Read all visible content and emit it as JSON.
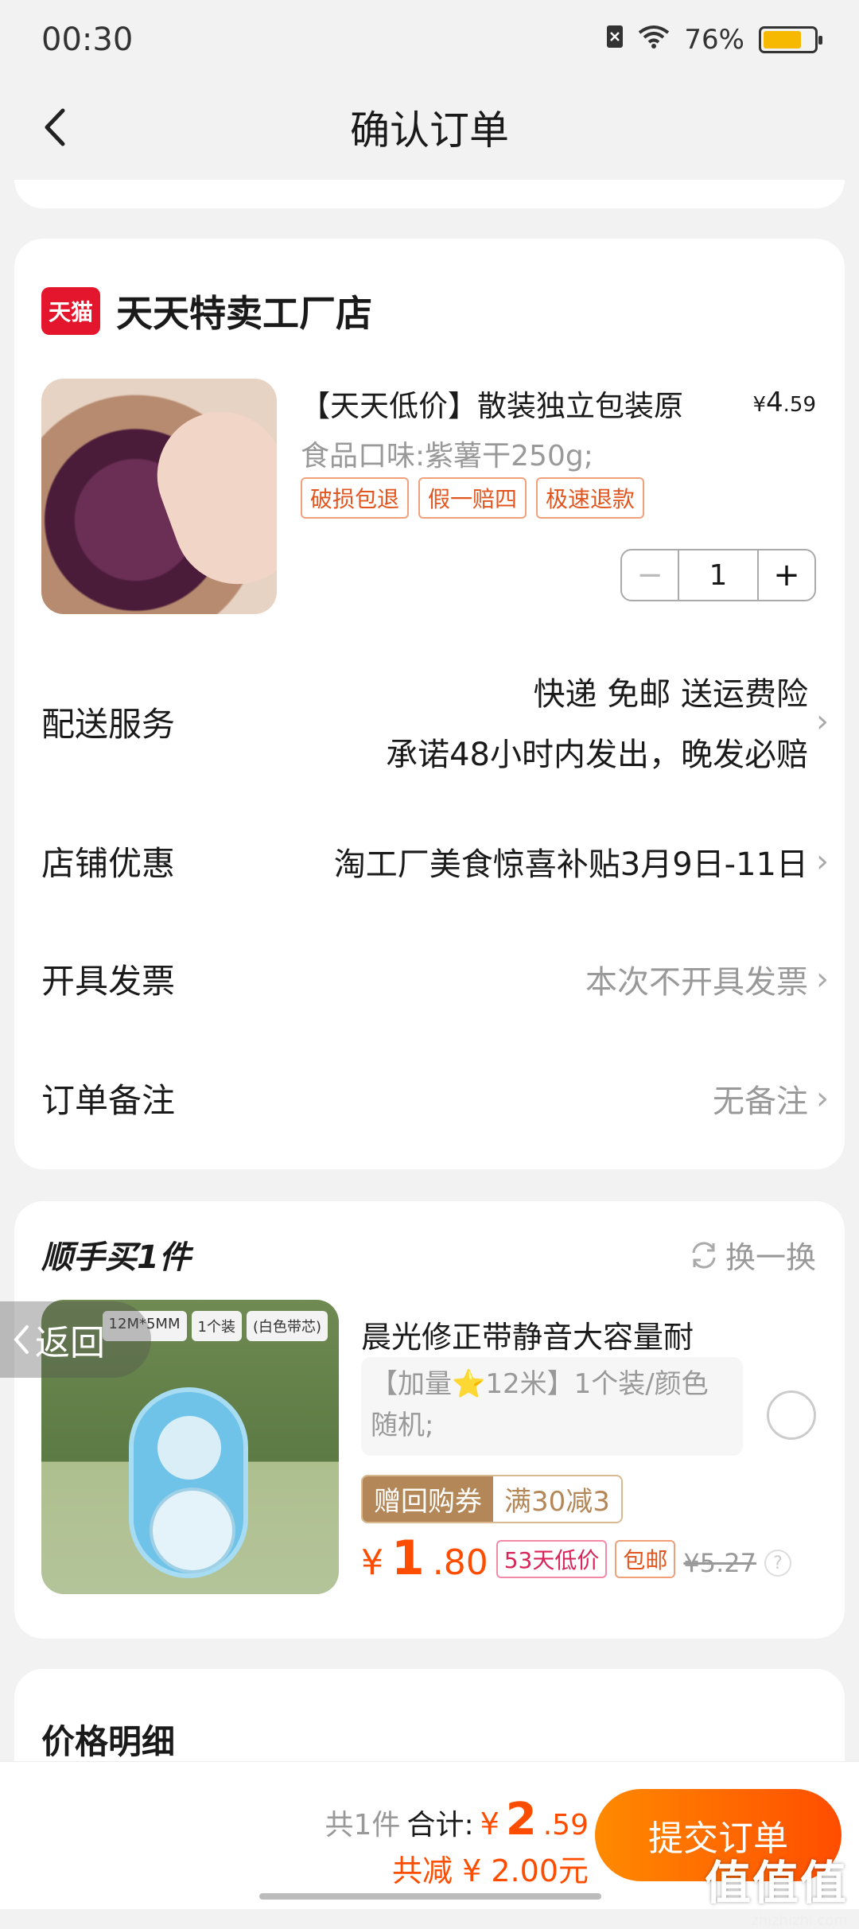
{
  "status": {
    "time": "00:30",
    "battery": "76%",
    "battery_level": 0.76
  },
  "nav": {
    "title": "确认订单"
  },
  "store": {
    "logo_text": "天猫",
    "name": "天天特卖工厂店",
    "product": {
      "title": "【天天低价】散装独立包装原",
      "price_symbol": "¥",
      "price_int": "4",
      "price_dec": ".59",
      "spec": "食品口味:紫薯干250g;",
      "tags": [
        "破损包退",
        "假一赔四",
        "极速退款"
      ],
      "quantity": "1",
      "minus": "−",
      "plus": "+"
    },
    "rows": {
      "shipping": {
        "label": "配送服务",
        "line1": "快递 免邮 送运费险",
        "line2": "承诺48小时内发出，晚发必赔"
      },
      "discount": {
        "label": "店铺优惠",
        "value": "淘工厂美食惊喜补贴3月9日-11日"
      },
      "invoice": {
        "label": "开具发票",
        "value": "本次不开具发票"
      },
      "note": {
        "label": "订单备注",
        "value": "无备注"
      }
    }
  },
  "addon": {
    "title": "顺手买1件",
    "swap_label": "换一换",
    "image_badges": [
      "12M*5MM",
      "1个装",
      "(白色带芯)"
    ],
    "name": "晨光修正带静音大容量耐",
    "spec": "【加量⭐12米】1个装/颜色随机;",
    "coupon_a": "赠回购券",
    "coupon_b": "满30减3",
    "price_symbol": "¥",
    "price_int": "1",
    "price_dec": ".80",
    "tag_low": "53天低价",
    "tag_ship": "包邮",
    "original_price": "¥5.27"
  },
  "return_pill": {
    "label": "返回"
  },
  "price_detail": {
    "title": "价格明细"
  },
  "bottom": {
    "count": "共1件",
    "total_label": "合计:",
    "total_symbol": "¥",
    "total_int": "2",
    "total_dec": ".59",
    "discount": "共减 ¥ 2.00元",
    "submit": "提交订单"
  },
  "watermark": {
    "main": "值值值",
    "sub": "zhizhizhi.com"
  }
}
